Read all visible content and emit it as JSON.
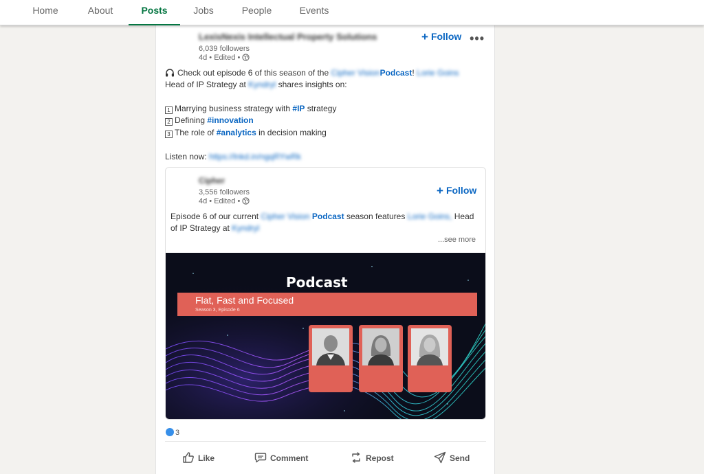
{
  "nav": {
    "tabs": [
      "Home",
      "About",
      "Posts",
      "Jobs",
      "People",
      "Events"
    ],
    "active": "Posts"
  },
  "post": {
    "author": "LexisNexis Intellectual Property Solutions",
    "followers": "6,039 followers",
    "time": "4d • Edited •",
    "follow_label": "Follow",
    "more_label": "•••",
    "intro_pre": "Check out episode 6 of this season of the",
    "intro_link": "Cipher Vision",
    "intro_podcast": "Podcast",
    "intro_mark": "!",
    "guest": "Lorie Goins",
    "line2_pre": "Head of IP Strategy at",
    "company": "Kyndryl",
    "line2_post": "shares insights on:",
    "items": [
      {
        "num": "1",
        "pre": "Marrying business strategy with",
        "tag": "#IP",
        "post": "strategy"
      },
      {
        "num": "2",
        "pre": "Defining",
        "tag": "#innovation",
        "post": ""
      },
      {
        "num": "3",
        "pre": "The role of",
        "tag": "#analytics",
        "post": "in decision making"
      }
    ],
    "listen_label": "Listen now:",
    "listen_url": "https://lnkd.in/ngqRYwRk"
  },
  "reshare": {
    "author": "Cipher",
    "followers": "3,556 followers",
    "time": "4d • Edited •",
    "follow_label": "Follow",
    "text_pre": "Episode 6 of our current",
    "text_link": "Cipher Vision",
    "text_podcast": "Podcast",
    "text_mid": "season features",
    "text_guest": "Lorie Goins,",
    "text_post": "Head",
    "line2_pre": "of IP Strategy at",
    "line2_company": "Kyndryl",
    "see_more": "...see more"
  },
  "podcast": {
    "title": "Podcast",
    "episode_title": "Flat, Fast and Focused",
    "episode_sub": "Season 3, Episode 6"
  },
  "footer": {
    "reaction_count": "3",
    "actions": [
      "Like",
      "Comment",
      "Repost",
      "Send"
    ]
  },
  "colors": {
    "accent_green": "#057642",
    "link_blue": "#0a66c2",
    "banner_red": "#e06157"
  }
}
